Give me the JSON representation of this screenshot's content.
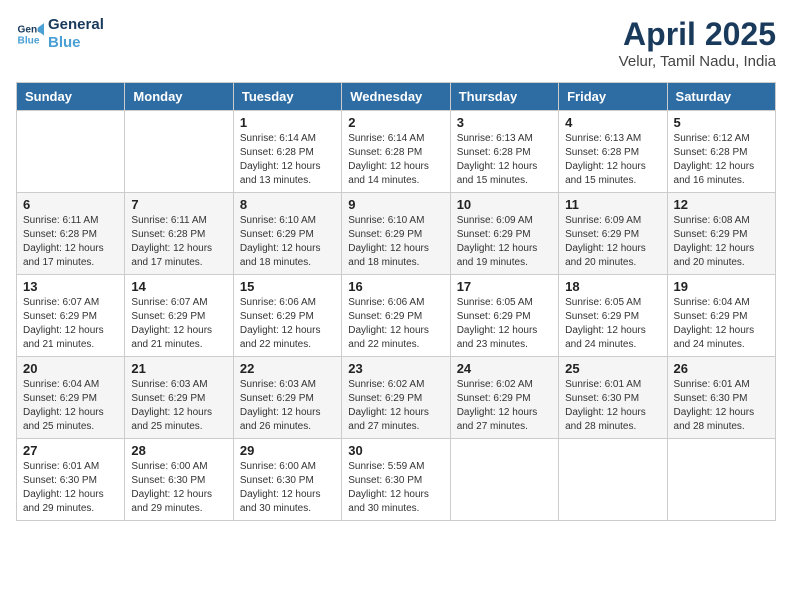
{
  "header": {
    "logo_line1": "General",
    "logo_line2": "Blue",
    "title": "April 2025",
    "subtitle": "Velur, Tamil Nadu, India"
  },
  "days_of_week": [
    "Sunday",
    "Monday",
    "Tuesday",
    "Wednesday",
    "Thursday",
    "Friday",
    "Saturday"
  ],
  "weeks": [
    [
      {
        "day": "",
        "info": ""
      },
      {
        "day": "",
        "info": ""
      },
      {
        "day": "1",
        "info": "Sunrise: 6:14 AM\nSunset: 6:28 PM\nDaylight: 12 hours and 13 minutes."
      },
      {
        "day": "2",
        "info": "Sunrise: 6:14 AM\nSunset: 6:28 PM\nDaylight: 12 hours and 14 minutes."
      },
      {
        "day": "3",
        "info": "Sunrise: 6:13 AM\nSunset: 6:28 PM\nDaylight: 12 hours and 15 minutes."
      },
      {
        "day": "4",
        "info": "Sunrise: 6:13 AM\nSunset: 6:28 PM\nDaylight: 12 hours and 15 minutes."
      },
      {
        "day": "5",
        "info": "Sunrise: 6:12 AM\nSunset: 6:28 PM\nDaylight: 12 hours and 16 minutes."
      }
    ],
    [
      {
        "day": "6",
        "info": "Sunrise: 6:11 AM\nSunset: 6:28 PM\nDaylight: 12 hours and 17 minutes."
      },
      {
        "day": "7",
        "info": "Sunrise: 6:11 AM\nSunset: 6:28 PM\nDaylight: 12 hours and 17 minutes."
      },
      {
        "day": "8",
        "info": "Sunrise: 6:10 AM\nSunset: 6:29 PM\nDaylight: 12 hours and 18 minutes."
      },
      {
        "day": "9",
        "info": "Sunrise: 6:10 AM\nSunset: 6:29 PM\nDaylight: 12 hours and 18 minutes."
      },
      {
        "day": "10",
        "info": "Sunrise: 6:09 AM\nSunset: 6:29 PM\nDaylight: 12 hours and 19 minutes."
      },
      {
        "day": "11",
        "info": "Sunrise: 6:09 AM\nSunset: 6:29 PM\nDaylight: 12 hours and 20 minutes."
      },
      {
        "day": "12",
        "info": "Sunrise: 6:08 AM\nSunset: 6:29 PM\nDaylight: 12 hours and 20 minutes."
      }
    ],
    [
      {
        "day": "13",
        "info": "Sunrise: 6:07 AM\nSunset: 6:29 PM\nDaylight: 12 hours and 21 minutes."
      },
      {
        "day": "14",
        "info": "Sunrise: 6:07 AM\nSunset: 6:29 PM\nDaylight: 12 hours and 21 minutes."
      },
      {
        "day": "15",
        "info": "Sunrise: 6:06 AM\nSunset: 6:29 PM\nDaylight: 12 hours and 22 minutes."
      },
      {
        "day": "16",
        "info": "Sunrise: 6:06 AM\nSunset: 6:29 PM\nDaylight: 12 hours and 22 minutes."
      },
      {
        "day": "17",
        "info": "Sunrise: 6:05 AM\nSunset: 6:29 PM\nDaylight: 12 hours and 23 minutes."
      },
      {
        "day": "18",
        "info": "Sunrise: 6:05 AM\nSunset: 6:29 PM\nDaylight: 12 hours and 24 minutes."
      },
      {
        "day": "19",
        "info": "Sunrise: 6:04 AM\nSunset: 6:29 PM\nDaylight: 12 hours and 24 minutes."
      }
    ],
    [
      {
        "day": "20",
        "info": "Sunrise: 6:04 AM\nSunset: 6:29 PM\nDaylight: 12 hours and 25 minutes."
      },
      {
        "day": "21",
        "info": "Sunrise: 6:03 AM\nSunset: 6:29 PM\nDaylight: 12 hours and 25 minutes."
      },
      {
        "day": "22",
        "info": "Sunrise: 6:03 AM\nSunset: 6:29 PM\nDaylight: 12 hours and 26 minutes."
      },
      {
        "day": "23",
        "info": "Sunrise: 6:02 AM\nSunset: 6:29 PM\nDaylight: 12 hours and 27 minutes."
      },
      {
        "day": "24",
        "info": "Sunrise: 6:02 AM\nSunset: 6:29 PM\nDaylight: 12 hours and 27 minutes."
      },
      {
        "day": "25",
        "info": "Sunrise: 6:01 AM\nSunset: 6:30 PM\nDaylight: 12 hours and 28 minutes."
      },
      {
        "day": "26",
        "info": "Sunrise: 6:01 AM\nSunset: 6:30 PM\nDaylight: 12 hours and 28 minutes."
      }
    ],
    [
      {
        "day": "27",
        "info": "Sunrise: 6:01 AM\nSunset: 6:30 PM\nDaylight: 12 hours and 29 minutes."
      },
      {
        "day": "28",
        "info": "Sunrise: 6:00 AM\nSunset: 6:30 PM\nDaylight: 12 hours and 29 minutes."
      },
      {
        "day": "29",
        "info": "Sunrise: 6:00 AM\nSunset: 6:30 PM\nDaylight: 12 hours and 30 minutes."
      },
      {
        "day": "30",
        "info": "Sunrise: 5:59 AM\nSunset: 6:30 PM\nDaylight: 12 hours and 30 minutes."
      },
      {
        "day": "",
        "info": ""
      },
      {
        "day": "",
        "info": ""
      },
      {
        "day": "",
        "info": ""
      }
    ]
  ]
}
